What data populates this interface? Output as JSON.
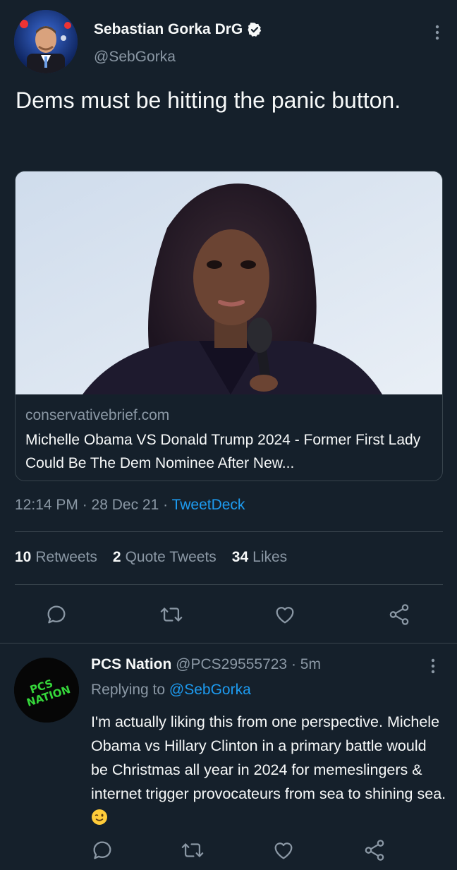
{
  "tweet": {
    "author_name": "Sebastian Gorka DrG",
    "author_handle": "@SebGorka",
    "text": "Dems must be hitting the panic button.",
    "card": {
      "domain": "conservativebrief.com",
      "title": "Michelle Obama VS Donald Trump 2024 - Former First Lady Could Be The Dem Nominee After New..."
    },
    "time": "12:14 PM · 28 Dec 21 · ",
    "source": "TweetDeck",
    "stats": {
      "retweets_count": "10",
      "retweets_label": "Retweets",
      "quotes_count": "2",
      "quotes_label": "Quote Tweets",
      "likes_count": "34",
      "likes_label": "Likes"
    }
  },
  "reply": {
    "author_name": "PCS Nation",
    "meta": " @PCS29555723 · 5m",
    "replying_prefix": "Replying to ",
    "replying_handle": "@SebGorka",
    "text": "I'm actually liking this from one perspective. Michele Obama vs Hillary Clinton in a primary battle would be Christmas all year in 2024 for memeslingers & internet trigger provocateurs from sea to shining sea. ",
    "avatar_text": "PCS NATION"
  },
  "icons": {
    "verified": "verified-badge-icon",
    "more": "more-vertical-icon",
    "reply": "reply-icon",
    "retweet": "retweet-icon",
    "like": "like-icon",
    "share": "share-icon",
    "emoji": "winking-face-emoji"
  },
  "colors": {
    "background": "#15202b",
    "text": "#f7f9f9",
    "muted": "#8b98a5",
    "accent": "#1d9bf0",
    "border": "#38444d",
    "avatar_text": "#35d63a"
  }
}
